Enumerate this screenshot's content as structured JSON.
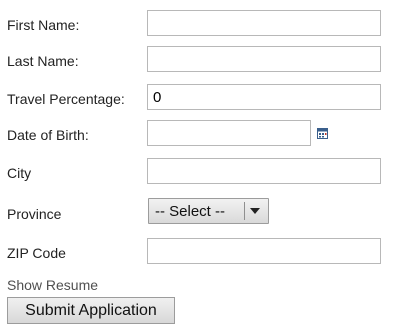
{
  "form": {
    "fields": {
      "first_name": {
        "label": "First Name:",
        "value": ""
      },
      "last_name": {
        "label": "Last Name:",
        "value": ""
      },
      "travel_percentage": {
        "label": "Travel Percentage:",
        "value": "0"
      },
      "date_of_birth": {
        "label": "Date of Birth:",
        "value": "",
        "icon": "calendar-icon"
      },
      "city": {
        "label": "City",
        "value": ""
      },
      "province": {
        "label": "Province",
        "selected": "-- Select --",
        "icon": "chevron-down-icon"
      },
      "zip_code": {
        "label": "ZIP Code",
        "value": ""
      }
    },
    "show_resume_label": "Show Resume",
    "submit_label": "Submit Application"
  },
  "colors": {
    "input_border": "#b8b8b8",
    "button_border": "#9c9c9c",
    "text": "#222222",
    "link_text": "#505050"
  }
}
